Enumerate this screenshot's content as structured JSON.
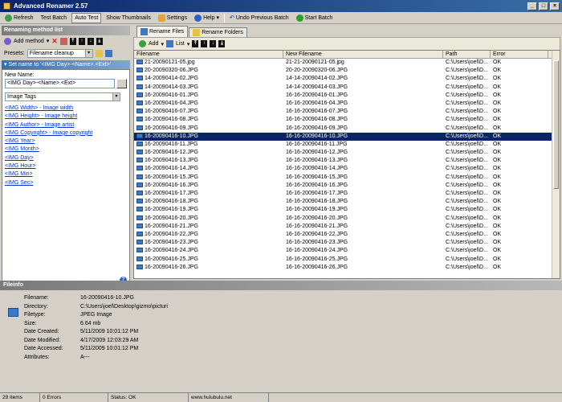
{
  "window": {
    "title": "Advanced Renamer 2.57"
  },
  "toolbar": {
    "refresh": "Refresh",
    "test_batch": "Test Batch",
    "auto_test": "Auto Test",
    "show_thumbnails": "Show Thumbnails",
    "settings": "Settings",
    "help": "Help",
    "undo": "Undo Previous Batch",
    "start_batch": "Start Batch"
  },
  "methods": {
    "header": "Renaming method list",
    "add_method": "Add method",
    "presets_label": "Presets:",
    "preset_value": "Filename cleanup",
    "method_title": "Set name to '<IMG Day>-<Name>.<Ext>'",
    "new_name_label": "New Name:",
    "new_name_value": "<IMG Day>-<Name>.<Ext>",
    "tag_category": "Image Tags",
    "tags": [
      "<IMG Width> - Image width",
      "<IMG Height> - Image height",
      "<IMG Author> - Image artist",
      "<IMG Copyright> - Image copyright",
      "<IMG Year>",
      "<IMG Month>",
      "<IMG Day>",
      "<IMG Hour>",
      "<IMG Min>",
      "<IMG Sec>"
    ]
  },
  "files": {
    "tab_files": "Rename Files",
    "tab_folders": "Rename Folders",
    "add": "Add",
    "list": "List",
    "columns": [
      "Filename",
      "New Filename",
      "Path",
      "Error"
    ],
    "selected_index": 9,
    "rows": [
      [
        "21-20090121-05.jpg",
        "21-21-20090121-05.jpg",
        "C:\\Users\\joel\\D...",
        "OK"
      ],
      [
        "20-20090320-06.JPG",
        "20-20-20090320-06.JPG",
        "C:\\Users\\joel\\D...",
        "OK"
      ],
      [
        "14-20090414-02.JPG",
        "14-14-20090414-02.JPG",
        "C:\\Users\\joel\\D...",
        "OK"
      ],
      [
        "14-20090414-03.JPG",
        "14-14-20090414-03.JPG",
        "C:\\Users\\joel\\D...",
        "OK"
      ],
      [
        "16-20090416-01.JPG",
        "16-16-20090416-01.JPG",
        "C:\\Users\\joel\\D...",
        "OK"
      ],
      [
        "16-20090416-04.JPG",
        "16-16-20090416-04.JPG",
        "C:\\Users\\joel\\D...",
        "OK"
      ],
      [
        "16-20090416-07.JPG",
        "16-16-20090416-07.JPG",
        "C:\\Users\\joel\\D...",
        "OK"
      ],
      [
        "16-20090416-08.JPG",
        "16-16-20090416-08.JPG",
        "C:\\Users\\joel\\D...",
        "OK"
      ],
      [
        "16-20090416-09.JPG",
        "16-16-20090416-09.JPG",
        "C:\\Users\\joel\\D...",
        "OK"
      ],
      [
        "16-20090416-10.JPG",
        "16-16-20090416-10.JPG",
        "C:\\Users\\joel\\D...",
        "OK"
      ],
      [
        "16-20090416-11.JPG",
        "16-16-20090416-11.JPG",
        "C:\\Users\\joel\\D...",
        "OK"
      ],
      [
        "16-20090416-12.JPG",
        "16-16-20090416-12.JPG",
        "C:\\Users\\joel\\D...",
        "OK"
      ],
      [
        "16-20090416-13.JPG",
        "16-16-20090416-13.JPG",
        "C:\\Users\\joel\\D...",
        "OK"
      ],
      [
        "16-20090416-14.JPG",
        "16-16-20090416-14.JPG",
        "C:\\Users\\joel\\D...",
        "OK"
      ],
      [
        "16-20090416-15.JPG",
        "16-16-20090416-15.JPG",
        "C:\\Users\\joel\\D...",
        "OK"
      ],
      [
        "16-20090416-16.JPG",
        "16-16-20090416-16.JPG",
        "C:\\Users\\joel\\D...",
        "OK"
      ],
      [
        "16-20090416-17.JPG",
        "16-16-20090416-17.JPG",
        "C:\\Users\\joel\\D...",
        "OK"
      ],
      [
        "16-20090416-18.JPG",
        "16-16-20090416-18.JPG",
        "C:\\Users\\joel\\D...",
        "OK"
      ],
      [
        "16-20090416-19.JPG",
        "16-16-20090416-19.JPG",
        "C:\\Users\\joel\\D...",
        "OK"
      ],
      [
        "16-20090416-20.JPG",
        "16-16-20090416-20.JPG",
        "C:\\Users\\joel\\D...",
        "OK"
      ],
      [
        "16-20090416-21.JPG",
        "16-16-20090416-21.JPG",
        "C:\\Users\\joel\\D...",
        "OK"
      ],
      [
        "16-20090416-22.JPG",
        "16-16-20090416-22.JPG",
        "C:\\Users\\joel\\D...",
        "OK"
      ],
      [
        "16-20090416-23.JPG",
        "16-16-20090416-23.JPG",
        "C:\\Users\\joel\\D...",
        "OK"
      ],
      [
        "16-20090416-24.JPG",
        "16-16-20090416-24.JPG",
        "C:\\Users\\joel\\D...",
        "OK"
      ],
      [
        "16-20090416-25.JPG",
        "16-16-20090416-25.JPG",
        "C:\\Users\\joel\\D...",
        "OK"
      ],
      [
        "16-20090416-26.JPG",
        "16-16-20090416-26.JPG",
        "C:\\Users\\joel\\D...",
        "OK"
      ]
    ]
  },
  "fileinfo": {
    "header": "Fileinfo",
    "fields": [
      [
        "Filename:",
        "16-20090416-10.JPG"
      ],
      [
        "Directory:",
        "C:\\Users\\joel\\Desktop\\gizmo\\picturi"
      ],
      [
        "Filetype:",
        "JPEG Image"
      ],
      [
        "Size:",
        "6.64 mb"
      ],
      [
        "Date Created:",
        "5/11/2009 10:01:12 PM"
      ],
      [
        "Date Modified:",
        "4/17/2009 12:03:29 AM"
      ],
      [
        "Date Accessed:",
        "5/11/2009 10:01:12 PM"
      ],
      [
        "Attributes:",
        "A---"
      ]
    ]
  },
  "status": {
    "items": "29 Items",
    "errors": "0 Errors",
    "status": "Status: OK",
    "url": "www.hulubulu.net"
  }
}
